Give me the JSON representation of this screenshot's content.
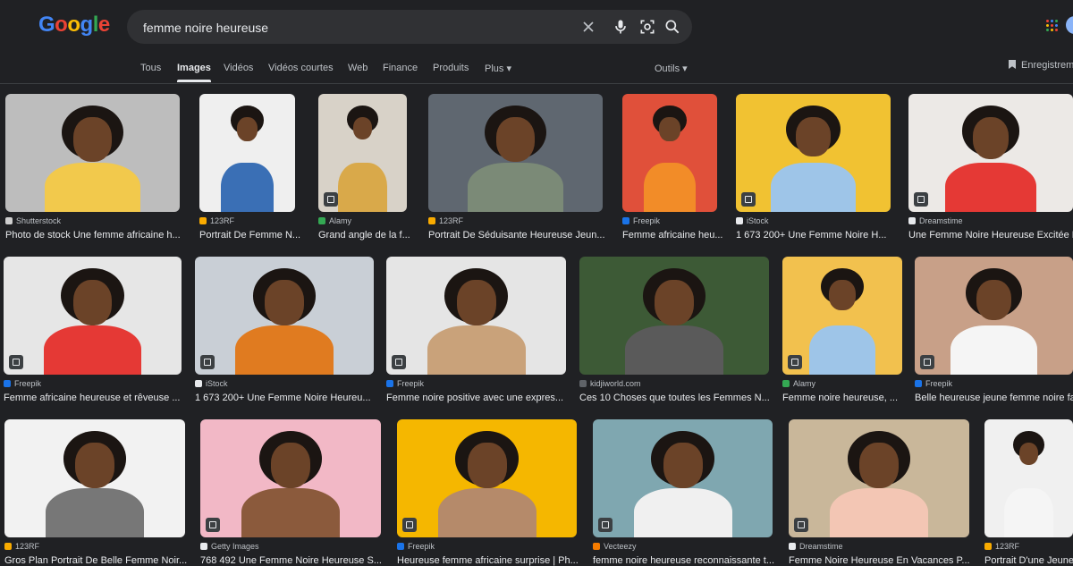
{
  "logo": "Google",
  "search": {
    "query": "femme noire heureuse"
  },
  "tabs": [
    {
      "label": "Tous"
    },
    {
      "label": "Images",
      "active": true
    },
    {
      "label": "Vidéos"
    },
    {
      "label": "Vidéos courtes"
    },
    {
      "label": "Web"
    },
    {
      "label": "Finance"
    },
    {
      "label": "Produits"
    },
    {
      "label": "Plus ▾"
    }
  ],
  "tools_label": "Outils ▾",
  "saved_label": "Enregistrements",
  "results": [
    {
      "source": "Shutterstock",
      "title": "Photo de stock Une femme africaine h...",
      "bg": "#bdbdbd",
      "shirt": "#f2c94c",
      "fav": "#cfcfcf"
    },
    {
      "source": "123RF",
      "title": "Portrait De Femme N...",
      "bg": "#efefef",
      "shirt": "#3a6fb5",
      "fav": "#f9ab00"
    },
    {
      "source": "Alamy",
      "title": "Grand angle de la f...",
      "bg": "#d8d2c8",
      "shirt": "#d9a94a",
      "fav": "#34a853"
    },
    {
      "source": "123RF",
      "title": "Portrait De Séduisante Heureuse Jeun...",
      "bg": "#5f6770",
      "shirt": "#7b8a77",
      "fav": "#f9ab00"
    },
    {
      "source": "Freepik",
      "title": "Femme africaine heu...",
      "bg": "#e0503a",
      "shirt": "#f28c28",
      "fav": "#1a73e8"
    },
    {
      "source": "iStock",
      "title": "1 673 200+ Une Femme Noire H...",
      "bg": "#f1c232",
      "shirt": "#9ec5e8",
      "fav": "#e8eaed"
    },
    {
      "source": "Dreamstime",
      "title": "Une Femme Noire Heureuse Excitée Le...",
      "bg": "#ece9e6",
      "shirt": "#e53935",
      "fav": "#e8eaed"
    },
    {
      "source": "Freepik",
      "title": "Femme africaine heureuse et rêveuse ...",
      "bg": "#e6e6e6",
      "shirt": "#e53935",
      "fav": "#1a73e8"
    },
    {
      "source": "iStock",
      "title": "1 673 200+ Une Femme Noire Heureu...",
      "bg": "#c9cfd6",
      "shirt": "#e07b20",
      "fav": "#e8eaed"
    },
    {
      "source": "Freepik",
      "title": "Femme noire positive avec une expres...",
      "bg": "#e5e5e5",
      "shirt": "#c9a27a",
      "fav": "#1a73e8"
    },
    {
      "source": "kidjiworld.com",
      "title": "Ces 10 Choses que toutes les Femmes N...",
      "bg": "#3d5a36",
      "shirt": "#5a5a5a",
      "fav": "#5f6368"
    },
    {
      "source": "Alamy",
      "title": "Femme noire heureuse, ...",
      "bg": "#f2c14e",
      "shirt": "#9ec5e8",
      "fav": "#34a853"
    },
    {
      "source": "Freepik",
      "title": "Belle heureuse jeune femme noire fa...",
      "bg": "#c8a088",
      "shirt": "#f5f5f5",
      "fav": "#1a73e8"
    },
    {
      "source": "123RF",
      "title": "Gros Plan Portrait De Belle Femme Noir...",
      "bg": "#f2f2f2",
      "shirt": "#777777",
      "fav": "#f9ab00"
    },
    {
      "source": "Getty Images",
      "title": "768 492 Une Femme Noire Heureuse S...",
      "bg": "#f2b8c6",
      "shirt": "#8b5a3c",
      "fav": "#e8eaed"
    },
    {
      "source": "Freepik",
      "title": "Heureuse femme africaine surprise | Ph...",
      "bg": "#f5b700",
      "shirt": "#b58a6a",
      "fav": "#1a73e8"
    },
    {
      "source": "Vecteezy",
      "title": "femme noire heureuse reconnaissante t...",
      "bg": "#7fa7b0",
      "shirt": "#f0f0f0",
      "fav": "#f57c00"
    },
    {
      "source": "Dreamstime",
      "title": "Femme Noire Heureuse En Vacances P...",
      "bg": "#c9b79a",
      "shirt": "#f3c6b4",
      "fav": "#e8eaed"
    },
    {
      "source": "123RF",
      "title": "Portrait D'une Jeune...",
      "bg": "#f0f0f0",
      "shirt": "#f5f5f5",
      "fav": "#f9ab00"
    }
  ]
}
